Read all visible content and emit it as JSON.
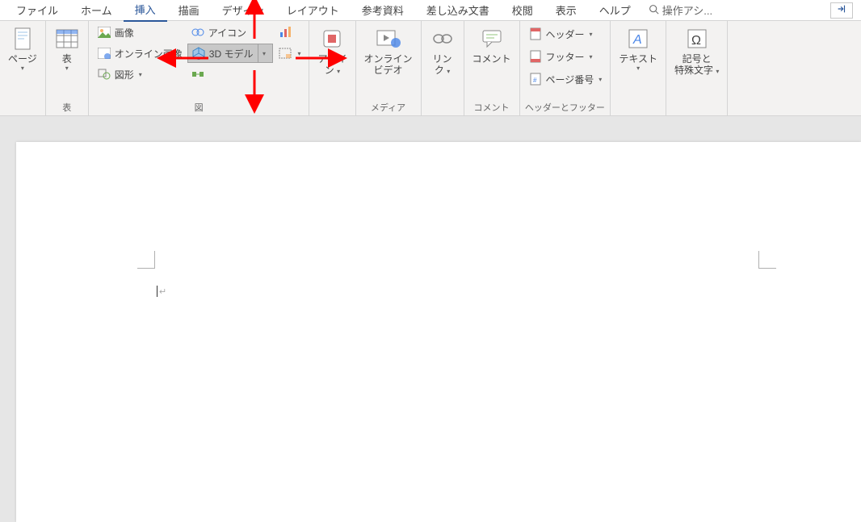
{
  "tabs": {
    "file": "ファイル",
    "home": "ホーム",
    "insert": "挿入",
    "draw": "描画",
    "design": "デザイン",
    "layout": "レイアウト",
    "references": "参考資料",
    "mailings": "差し込み文書",
    "review": "校閲",
    "view": "表示",
    "help": "ヘルプ"
  },
  "search": {
    "placeholder": "操作アシ..."
  },
  "groups": {
    "pages": {
      "label": "ページ",
      "group_name": ""
    },
    "tables": {
      "label": "表",
      "group_name": "表"
    },
    "illustrations": {
      "pictures": "画像",
      "online_pictures": "オンライン画像",
      "shapes": "図形",
      "icons": "アイコン",
      "models3d": "3D モデル",
      "smartart": "",
      "chart": "",
      "screenshot": "",
      "group_name": "図"
    },
    "addins": {
      "label1": "アドイ",
      "label2": "ン",
      "group_name": ""
    },
    "media": {
      "label1": "オンライン",
      "label2": "ビデオ",
      "group_name": "メディア"
    },
    "links": {
      "label1": "リン",
      "label2": "ク",
      "group_name": ""
    },
    "comments": {
      "label": "コメント",
      "group_name": "コメント"
    },
    "header_footer": {
      "header": "ヘッダー",
      "footer": "フッター",
      "page_number": "ページ番号",
      "group_name": "ヘッダーとフッター"
    },
    "text": {
      "label": "テキスト",
      "group_name": ""
    },
    "symbols": {
      "label1": "記号と",
      "label2": "特殊文字",
      "group_name": ""
    }
  },
  "paragraph_mark": "↵"
}
